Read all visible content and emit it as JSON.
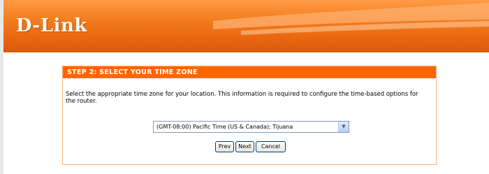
{
  "header": {
    "logo_text": "D-Link"
  },
  "wizard": {
    "step_title": "STEP 2: SELECT YOUR TIME ZONE",
    "instructions": "Select the appropriate time zone for your location. This information is required to configure the time-based options for the router.",
    "timezone_select": {
      "selected": "(GMT-08:00) Pacific Time (US & Canada); Tijuana"
    },
    "buttons": {
      "prev": "Prev",
      "next": "Next",
      "cancel": "Cancel"
    }
  },
  "colors": {
    "accent": "#ff6600",
    "card_border": "#f7b47a"
  }
}
